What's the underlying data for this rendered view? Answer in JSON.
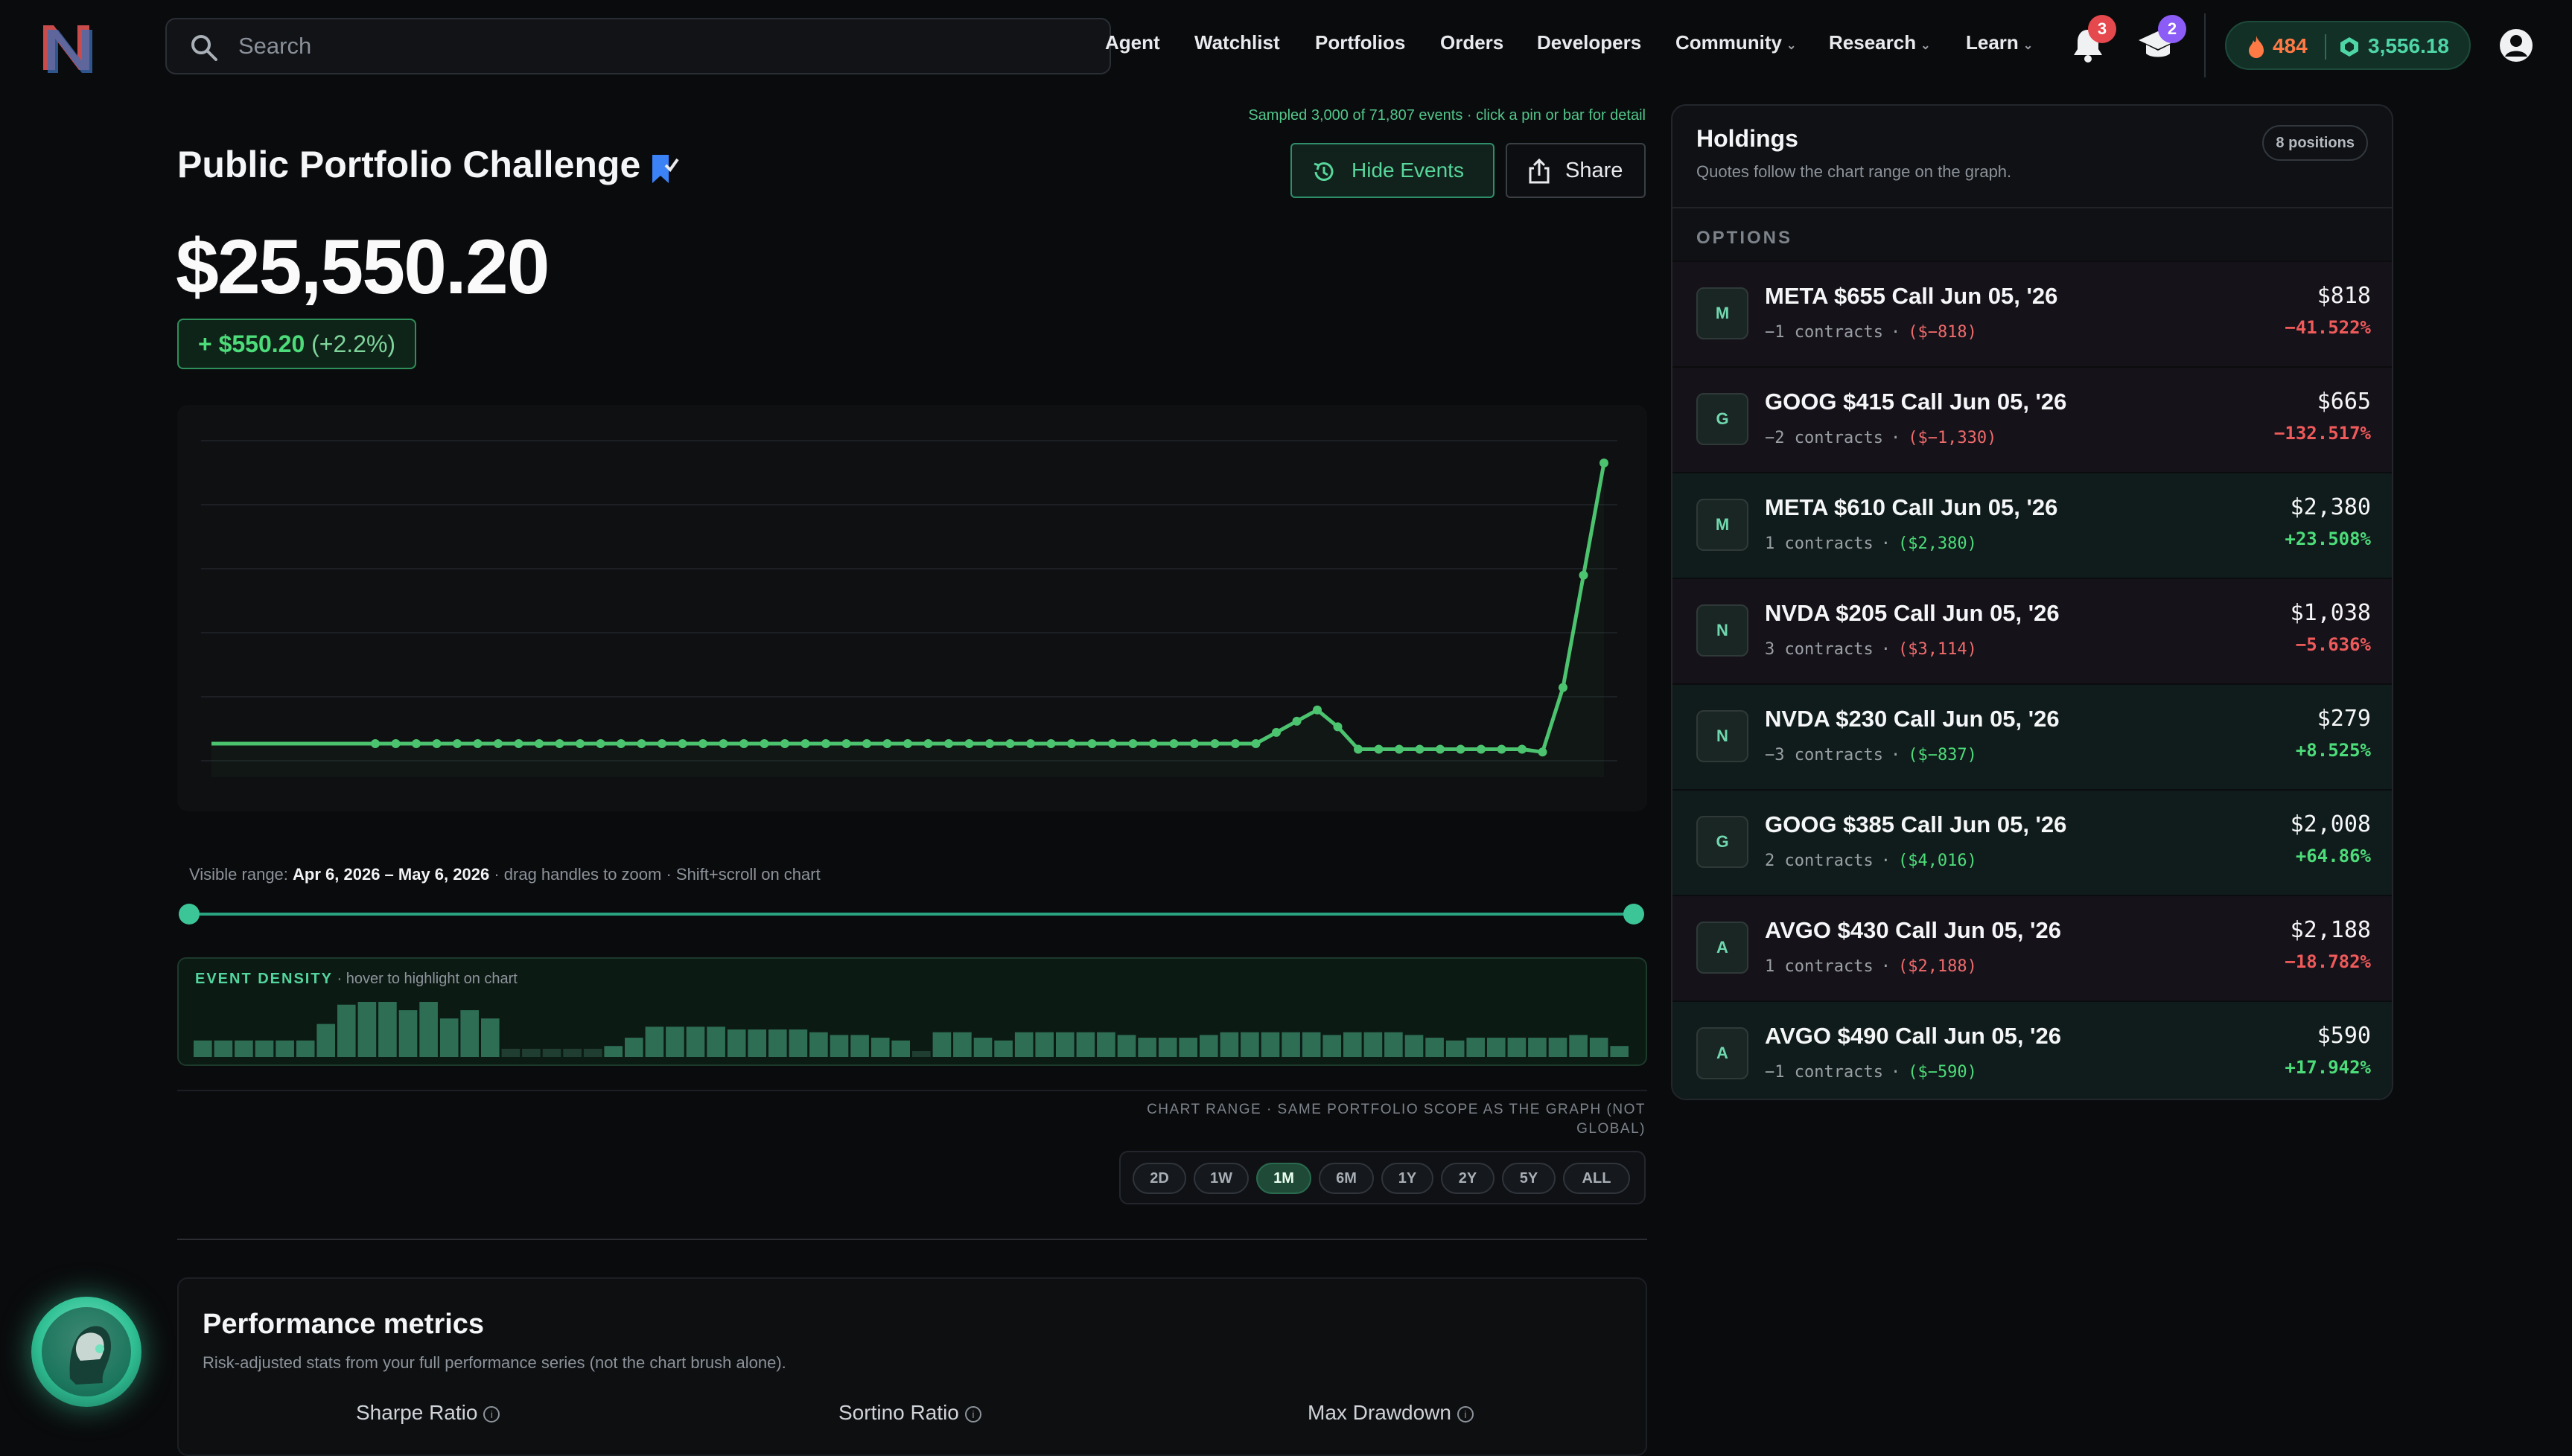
{
  "nav": {
    "search_placeholder": "Search",
    "links": [
      "Agent",
      "Watchlist",
      "Portfolios",
      "Orders",
      "Developers",
      "Community",
      "Research",
      "Learn"
    ],
    "notifications_count": "3",
    "learn_count": "2",
    "streak": "484",
    "gems": "3,556.18"
  },
  "header": {
    "sampled_note": "Sampled 3,000 of 71,807 events · click a pin or bar for detail",
    "title": "Public Portfolio Challenge",
    "hide_events_label": "Hide Events",
    "share_label": "Share"
  },
  "portfolio": {
    "value": "$25,550.20",
    "change_abs": "+ $550.20",
    "change_pct": "(+2.2%)"
  },
  "chart_data": {
    "type": "line",
    "title": "",
    "xlabel": "",
    "ylabel": "",
    "xlim": [
      "2026-04-06",
      "2026-05-06"
    ],
    "x_start": "2026-04-06",
    "x_end": "2026-05-06",
    "y_relative": [
      0,
      0,
      0,
      0,
      0,
      0,
      0,
      0,
      0,
      0,
      0,
      0,
      0,
      0,
      0,
      0,
      0,
      0,
      0,
      0,
      0,
      0,
      0,
      0,
      0,
      0,
      0,
      0,
      0,
      0,
      0,
      0,
      0,
      0,
      0,
      0,
      0,
      0,
      0,
      0,
      0,
      0,
      0,
      0,
      0,
      0,
      0,
      0,
      0,
      0,
      0,
      0,
      0.04,
      0.08,
      0.12,
      0.06,
      -0.02,
      -0.02,
      -0.02,
      -0.02,
      -0.02,
      -0.02,
      -0.02,
      -0.02,
      -0.02,
      -0.03,
      0.2,
      0.6,
      1.0
    ],
    "color": "#4cc36f",
    "grid": true
  },
  "range": {
    "label": "Visible range:",
    "value": "Apr 6, 2026 – May 6, 2026",
    "hint": "· drag handles to zoom · Shift+scroll on chart"
  },
  "density": {
    "label": "EVENT DENSITY",
    "hint": "· hover to highlight on chart",
    "values": [
      0.3,
      0.3,
      0.3,
      0.3,
      0.3,
      0.3,
      0.6,
      0.95,
      1.0,
      1.0,
      0.85,
      1.0,
      0.7,
      0.85,
      0.7,
      0.15,
      0.15,
      0.15,
      0.15,
      0.15,
      0.2,
      0.35,
      0.55,
      0.55,
      0.55,
      0.55,
      0.5,
      0.5,
      0.5,
      0.5,
      0.45,
      0.4,
      0.4,
      0.35,
      0.3,
      0.1,
      0.45,
      0.45,
      0.35,
      0.3,
      0.45,
      0.45,
      0.45,
      0.45,
      0.45,
      0.4,
      0.35,
      0.35,
      0.35,
      0.4,
      0.45,
      0.45,
      0.45,
      0.45,
      0.45,
      0.4,
      0.45,
      0.45,
      0.45,
      0.4,
      0.35,
      0.3,
      0.35,
      0.35,
      0.35,
      0.35,
      0.35,
      0.4,
      0.35,
      0.2
    ],
    "color": "#2e6e55"
  },
  "chart_range": {
    "caption": "CHART RANGE · SAME PORTFOLIO SCOPE AS THE GRAPH (NOT GLOBAL)",
    "options": [
      "2D",
      "1W",
      "1M",
      "6M",
      "1Y",
      "2Y",
      "5Y",
      "ALL"
    ],
    "selected": "1M"
  },
  "performance": {
    "title": "Performance metrics",
    "subtitle": "Risk-adjusted stats from your full performance series (not the chart brush alone).",
    "metrics": [
      "Sharpe Ratio",
      "Sortino Ratio",
      "Max Drawdown"
    ]
  },
  "holdings": {
    "title": "Holdings",
    "subtitle": "Quotes follow the chart range on the graph.",
    "count": "8 positions",
    "section": "OPTIONS",
    "items": [
      {
        "letter": "M",
        "name": "META $655 Call Jun 05, '26",
        "contracts": "−1 contracts",
        "cost": "($−818)",
        "value": "$818",
        "pct": "−41.522%",
        "direction": "neg"
      },
      {
        "letter": "G",
        "name": "GOOG $415 Call Jun 05, '26",
        "contracts": "−2 contracts",
        "cost": "($−1,330)",
        "value": "$665",
        "pct": "−132.517%",
        "direction": "neg"
      },
      {
        "letter": "M",
        "name": "META $610 Call Jun 05, '26",
        "contracts": "1 contracts",
        "cost": "($2,380)",
        "value": "$2,380",
        "pct": "+23.508%",
        "direction": "pos"
      },
      {
        "letter": "N",
        "name": "NVDA $205 Call Jun 05, '26",
        "contracts": "3 contracts",
        "cost": "($3,114)",
        "value": "$1,038",
        "pct": "−5.636%",
        "direction": "neg"
      },
      {
        "letter": "N",
        "name": "NVDA $230 Call Jun 05, '26",
        "contracts": "−3 contracts",
        "cost": "($−837)",
        "value": "$279",
        "pct": "+8.525%",
        "direction": "pos"
      },
      {
        "letter": "G",
        "name": "GOOG $385 Call Jun 05, '26",
        "contracts": "2 contracts",
        "cost": "($4,016)",
        "value": "$2,008",
        "pct": "+64.86%",
        "direction": "pos"
      },
      {
        "letter": "A",
        "name": "AVGO $430 Call Jun 05, '26",
        "contracts": "1 contracts",
        "cost": "($2,188)",
        "value": "$2,188",
        "pct": "−18.782%",
        "direction": "neg"
      },
      {
        "letter": "A",
        "name": "AVGO $490 Call Jun 05, '26",
        "contracts": "−1 contracts",
        "cost": "($−590)",
        "value": "$590",
        "pct": "+17.942%",
        "direction": "pos"
      }
    ]
  },
  "colors": {
    "accent": "#3cc597",
    "positive": "#4ddc7a",
    "negative": "#ef5a5a",
    "badge_red": "#e5484d",
    "badge_purple": "#8b5cf6",
    "streak": "#ff7a45",
    "gems": "#4fd6a6"
  }
}
